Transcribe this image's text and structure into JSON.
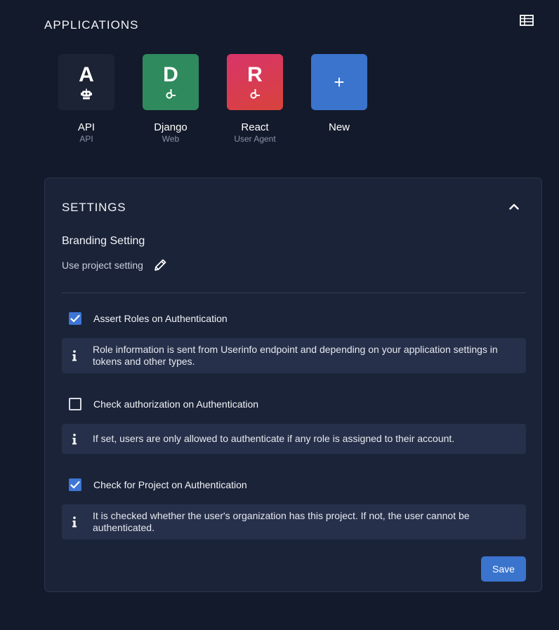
{
  "header": {
    "title": "APPLICATIONS"
  },
  "apps": [
    {
      "letter": "A",
      "name": "API",
      "type": "API",
      "color": "#1c2335",
      "sub_icon": "robot-icon"
    },
    {
      "letter": "D",
      "name": "Django",
      "type": "Web",
      "color": "#2f8a5d",
      "sub_icon": "link-icon"
    },
    {
      "letter": "R",
      "name": "React",
      "type": "User Agent",
      "color": "#d53c4a",
      "sub_icon": "link-icon"
    },
    {
      "letter": "+",
      "name": "New",
      "type": "",
      "color": "#3a74cc",
      "sub_icon": "plus-icon"
    }
  ],
  "settings": {
    "title": "SETTINGS",
    "branding_title": "Branding Setting",
    "branding_value": "Use project setting",
    "options": [
      {
        "label": "Assert Roles on Authentication",
        "checked": true,
        "info": "Role information is sent from Userinfo endpoint and depending on your application settings in tokens and other types."
      },
      {
        "label": "Check authorization on Authentication",
        "checked": false,
        "info": "If set, users are only allowed to authenticate if any role is assigned to their account."
      },
      {
        "label": "Check for Project on Authentication",
        "checked": true,
        "info": "It is checked whether the user's organization has this project. If not, the user cannot be authenticated."
      }
    ],
    "save_label": "Save"
  },
  "colors": {
    "background": "#131a2b",
    "card": "#1b2338",
    "info": "#27304a",
    "accent": "#3a74cc"
  }
}
